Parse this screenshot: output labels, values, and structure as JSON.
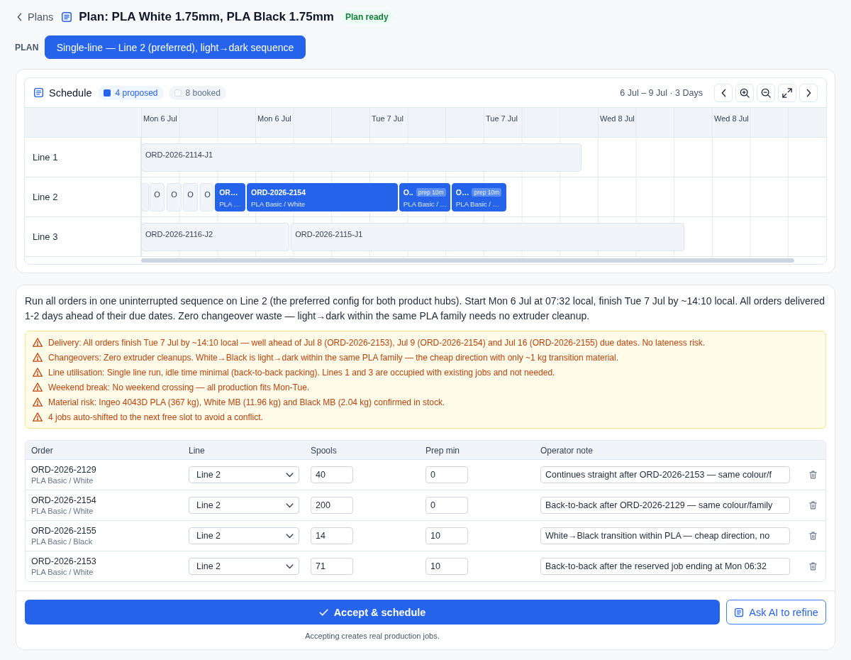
{
  "header": {
    "back_link": "Plans",
    "title": "Plan: PLA White 1.75mm, PLA Black 1.75mm",
    "status_badge": "Plan ready"
  },
  "plan_selector": {
    "label": "PLAN",
    "options": [
      {
        "label": "Single-line — Line 2 (preferred), light→dark sequence",
        "selected": true
      }
    ]
  },
  "schedule": {
    "title": "Schedule",
    "legend": [
      {
        "kind": "proposed",
        "label": "4 proposed"
      },
      {
        "kind": "booked",
        "label": "8 booked"
      }
    ],
    "range": "6 Jul – 9 Jul · 3 Days",
    "day_headers": [
      "Mon 6 Jul",
      "Mon 6 Jul",
      "Tue 7 Jul",
      "Tue 7 Jul",
      "Wed 8 Jul",
      "Wed 8 Jul"
    ],
    "lines": [
      {
        "name": "Line 1",
        "jobs": [
          {
            "kind": "booked",
            "title": "ORD-2026-2114-J1"
          }
        ]
      },
      {
        "name": "Line 2",
        "jobs": [
          {
            "kind": "booked"
          },
          {
            "kind": "booked",
            "title": "O"
          },
          {
            "kind": "booked",
            "title": "O"
          },
          {
            "kind": "booked",
            "title": "O"
          },
          {
            "kind": "booked",
            "title": "O"
          },
          {
            "kind": "proposed",
            "title": "OR…",
            "product": "PLA …"
          },
          {
            "kind": "proposed",
            "title": "ORD-2026-2154",
            "product": "PLA Basic / White"
          },
          {
            "kind": "proposed",
            "title": "O..",
            "badge": "prep 10m",
            "product": "PLA Basic / …"
          },
          {
            "kind": "proposed",
            "title": "O…",
            "badge": "prep 10m",
            "product": "PLA Basic / …"
          }
        ]
      },
      {
        "name": "Line 3",
        "jobs": [
          {
            "kind": "booked",
            "title": "ORD-2026-2116-J2"
          },
          {
            "kind": "booked",
            "title": "ORD-2026-2115-J1"
          }
        ]
      }
    ]
  },
  "summary": "Run all orders in one uninterrupted sequence on Line 2 (the preferred config for both product hubs). Start Mon 6 Jul at 07:32 local, finish Tue 7 Jul by ~14:10 local. All orders delivered 1-2 days ahead of their due dates. Zero changeover waste — light→dark within the same PLA family needs no extruder cleanup.",
  "warnings": [
    "Delivery: All orders finish Tue 7 Jul by ~14:10 local — well ahead of Jul 8 (ORD-2026-2153), Jul 9 (ORD-2026-2154) and Jul 16 (ORD-2026-2155) due dates. No lateness risk.",
    "Changeovers: Zero extruder cleanups. White→Black is light→dark within the same PLA family — the cheap direction with only ~1 kg transition material.",
    "Line utilisation: Single line run, idle time minimal (back-to-back packing). Lines 1 and 3 are occupied with existing jobs and not needed.",
    "Weekend break: No weekend crossing — all production fits Mon-Tue.",
    "Material risk: Ingeo 4043D PLA (367 kg), White MB (11.96 kg) and Black MB (2.04 kg) confirmed in stock.",
    "4 jobs auto-shifted to the next free slot to avoid a conflict."
  ],
  "table": {
    "columns": [
      "Order",
      "Line",
      "Spools",
      "Prep min",
      "Operator note"
    ],
    "rows": [
      {
        "order": "ORD-2026-2129",
        "product": "PLA Basic / White",
        "line": "Line 2",
        "spools": "40",
        "prep_min": "0",
        "operator_note": "Continues straight after ORD-2026-2153 — same colour/f"
      },
      {
        "order": "ORD-2026-2154",
        "product": "PLA Basic / White",
        "line": "Line 2",
        "spools": "200",
        "prep_min": "0",
        "operator_note": "Back-to-back after ORD-2026-2129 — same colour/family"
      },
      {
        "order": "ORD-2026-2155",
        "product": "PLA Basic / Black",
        "line": "Line 2",
        "spools": "14",
        "prep_min": "10",
        "operator_note": "White→Black transition within PLA — cheap direction, no"
      },
      {
        "order": "ORD-2026-2153",
        "product": "PLA Basic / White",
        "line": "Line 2",
        "spools": "71",
        "prep_min": "10",
        "operator_note": "Back-to-back after the reserved job ending at Mon 06:32"
      }
    ]
  },
  "actions": {
    "primary": "Accept & schedule",
    "secondary": "Ask AI to refine",
    "caption": "Accepting creates real production jobs."
  }
}
